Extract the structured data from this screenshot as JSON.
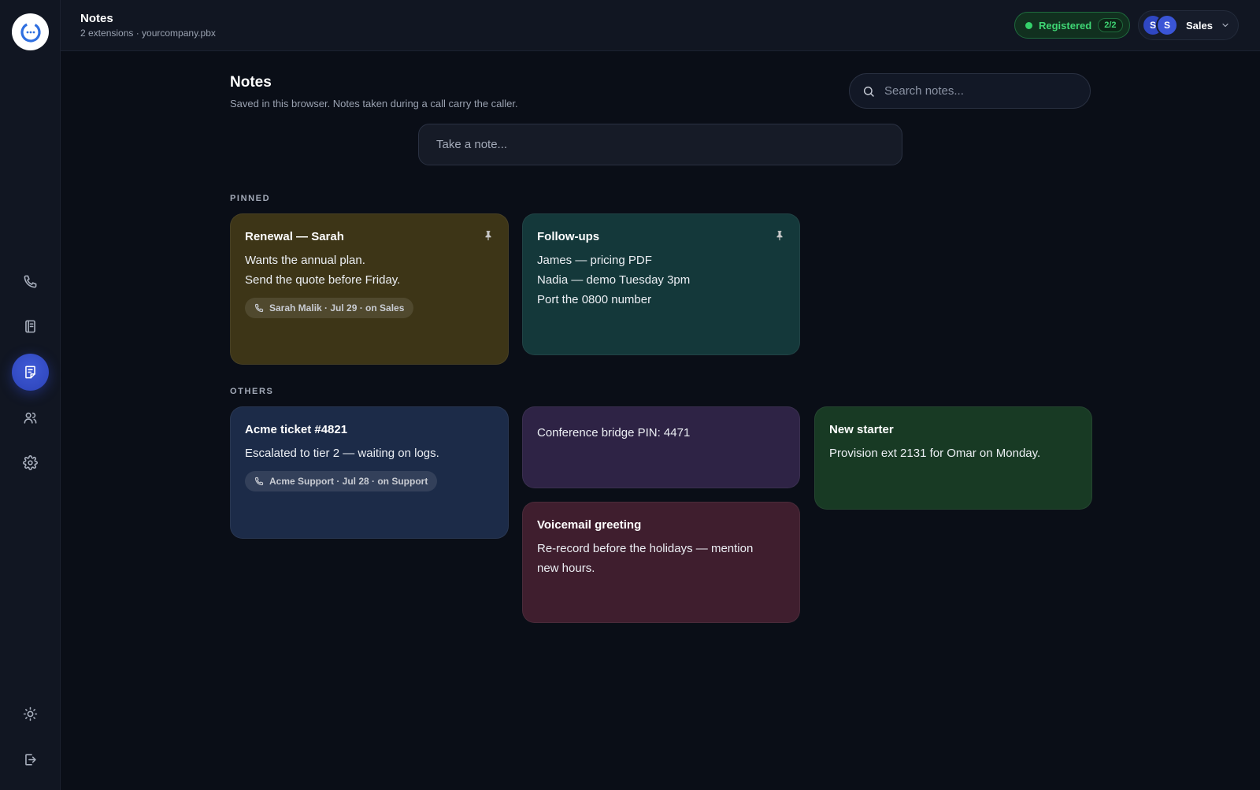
{
  "header": {
    "title": "Notes",
    "subtitle": "2 extensions · yourcompany.pbx",
    "status": {
      "label": "Registered",
      "count": "2/2",
      "color": "#34d06a"
    },
    "account": {
      "avatars": [
        "S",
        "S"
      ],
      "name": "Sales"
    }
  },
  "sidebar": {
    "items": [
      {
        "name": "phone",
        "icon": "phone-icon"
      },
      {
        "name": "contacts",
        "icon": "address-book-icon"
      },
      {
        "name": "notes",
        "icon": "notes-icon",
        "active": true
      },
      {
        "name": "team",
        "icon": "users-icon"
      },
      {
        "name": "settings",
        "icon": "gear-icon"
      }
    ],
    "bottom": [
      {
        "name": "theme",
        "icon": "sun-icon"
      },
      {
        "name": "logout",
        "icon": "logout-icon"
      }
    ],
    "accent": "#3048c8"
  },
  "main": {
    "title": "Notes",
    "subtitle": "Saved in this browser. Notes taken during a call carry the caller.",
    "search_placeholder": "Search notes...",
    "composer_placeholder": "Take a note...",
    "pinned_label": "PINNED",
    "others_label": "OTHERS"
  },
  "notes": {
    "renewal": {
      "title": "Renewal — Sarah",
      "lines": [
        "Wants the annual plan.",
        "Send the quote before Friday."
      ],
      "caller": "Sarah Malik · Jul 29 · on Sales",
      "color": "#3d3517",
      "pinned": true
    },
    "followups": {
      "title": "Follow-ups",
      "lines": [
        "James — pricing PDF",
        "Nadia — demo Tuesday 3pm",
        "Port the 0800 number"
      ],
      "color": "#14383a",
      "pinned": true
    },
    "acme": {
      "title": "Acme ticket #4821",
      "lines": [
        "Escalated to tier 2 — waiting on logs."
      ],
      "caller": "Acme Support · Jul 28 · on Support",
      "color": "#1c2b48"
    },
    "bridge": {
      "lines": [
        "Conference bridge PIN: 4471"
      ],
      "color": "#2e2345"
    },
    "starter": {
      "title": "New starter",
      "lines": [
        "Provision ext 2131 for Omar on Monday."
      ],
      "color": "#183a24"
    },
    "voicemail": {
      "title": "Voicemail greeting",
      "lines": [
        "Re-record before the holidays — mention",
        "new hours."
      ],
      "color": "#3f1e2e"
    }
  }
}
